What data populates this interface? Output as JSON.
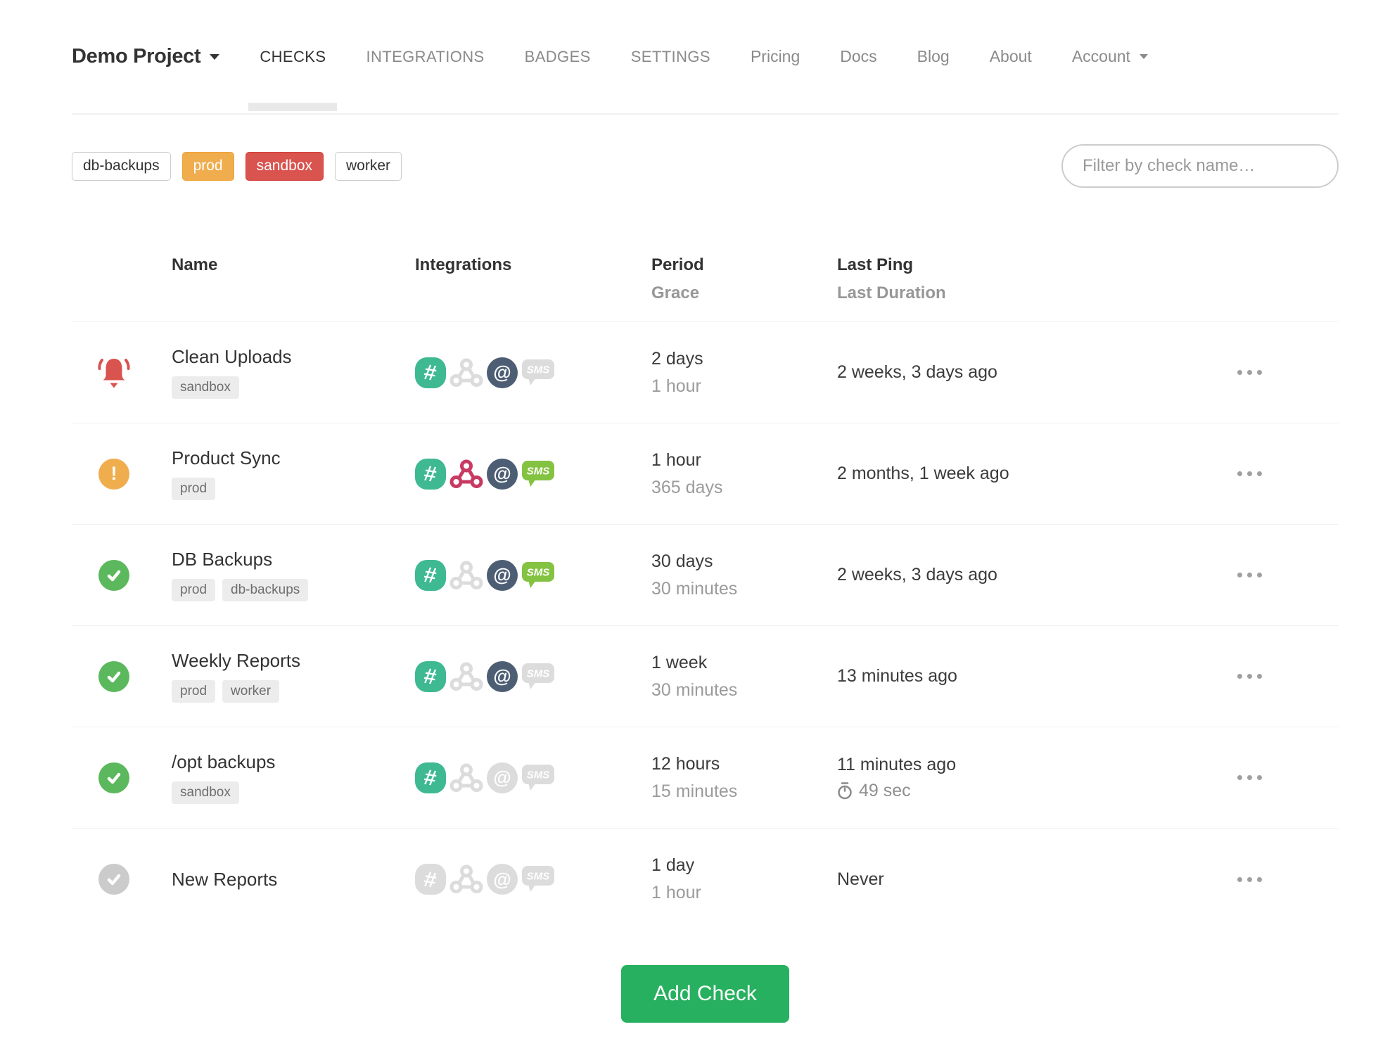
{
  "header": {
    "project_name": "Demo Project",
    "tabs": [
      {
        "label": "CHECKS",
        "active": true
      },
      {
        "label": "INTEGRATIONS",
        "active": false
      },
      {
        "label": "BADGES",
        "active": false
      },
      {
        "label": "SETTINGS",
        "active": false
      }
    ],
    "links": [
      "Pricing",
      "Docs",
      "Blog",
      "About"
    ],
    "account_label": "Account"
  },
  "filters": {
    "tags": [
      {
        "label": "db-backups",
        "style": "default"
      },
      {
        "label": "prod",
        "style": "warning"
      },
      {
        "label": "sandbox",
        "style": "danger"
      },
      {
        "label": "worker",
        "style": "default"
      }
    ],
    "search_placeholder": "Filter by check name…"
  },
  "table": {
    "headers": {
      "name": "Name",
      "integrations": "Integrations",
      "period": "Period",
      "grace": "Grace",
      "last_ping": "Last Ping",
      "last_duration": "Last Duration"
    },
    "rows": [
      {
        "status": "down",
        "name": "Clean Uploads",
        "tags": [
          "sandbox"
        ],
        "integrations": {
          "slack": true,
          "webhook": false,
          "email": true,
          "sms": false
        },
        "period": "2 days",
        "grace": "1 hour",
        "last_ping": "2 weeks, 3 days ago",
        "last_duration": null
      },
      {
        "status": "late",
        "name": "Product Sync",
        "tags": [
          "prod"
        ],
        "integrations": {
          "slack": true,
          "webhook": true,
          "email": true,
          "sms": true
        },
        "period": "1 hour",
        "grace": "365 days",
        "last_ping": "2 months, 1 week ago",
        "last_duration": null
      },
      {
        "status": "up",
        "name": "DB Backups",
        "tags": [
          "prod",
          "db-backups"
        ],
        "integrations": {
          "slack": true,
          "webhook": false,
          "email": true,
          "sms": true
        },
        "period": "30 days",
        "grace": "30 minutes",
        "last_ping": "2 weeks, 3 days ago",
        "last_duration": null
      },
      {
        "status": "up",
        "name": "Weekly Reports",
        "tags": [
          "prod",
          "worker"
        ],
        "integrations": {
          "slack": true,
          "webhook": false,
          "email": true,
          "sms": false
        },
        "period": "1 week",
        "grace": "30 minutes",
        "last_ping": "13 minutes ago",
        "last_duration": null
      },
      {
        "status": "up",
        "name": "/opt backups",
        "tags": [
          "sandbox"
        ],
        "integrations": {
          "slack": true,
          "webhook": false,
          "email": false,
          "sms": false
        },
        "period": "12 hours",
        "grace": "15 minutes",
        "last_ping": "11 minutes ago",
        "last_duration": "49 sec"
      },
      {
        "status": "new",
        "name": "New Reports",
        "tags": [],
        "integrations": {
          "slack": false,
          "webhook": false,
          "email": false,
          "sms": false
        },
        "period": "1 day",
        "grace": "1 hour",
        "last_ping": "Never",
        "last_duration": null
      }
    ]
  },
  "add_check_label": "Add Check",
  "icons": {
    "status_down": "bell-icon",
    "status_late": "exclamation-circle-icon",
    "status_up": "check-circle-icon",
    "status_new": "check-circle-icon",
    "integrations": [
      "slack-icon",
      "webhook-icon",
      "email-icon",
      "sms-icon"
    ],
    "duration": "stopwatch-icon",
    "row_menu": "ellipsis-icon",
    "caret": "chevron-down-icon"
  },
  "colors": {
    "status_up": "#5cb85c",
    "status_late": "#f0ad4e",
    "status_down": "#d9534f",
    "status_new": "#cbcbcb",
    "slack": "#3eb991",
    "webhook": "#c93a63",
    "email": "#4d5e74",
    "sms": "#84c341",
    "integration_inactive": "#dcdcdc",
    "add_check": "#27b05f"
  }
}
